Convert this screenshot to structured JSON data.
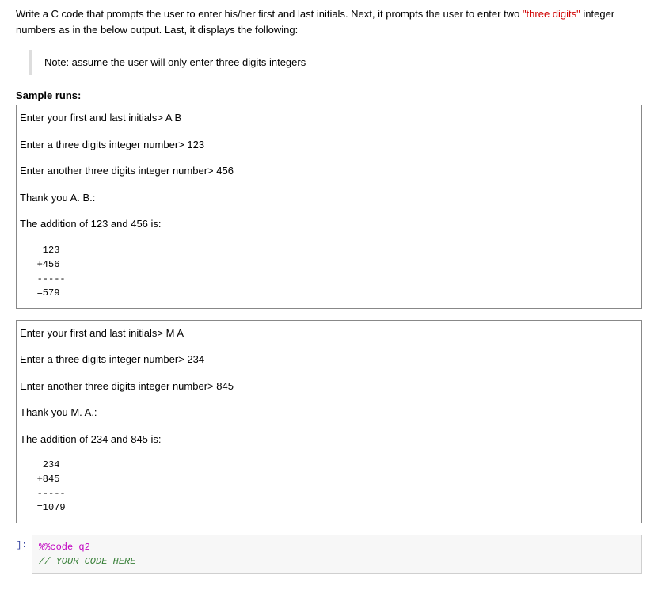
{
  "intro": {
    "part1": "Write a C code that prompts the user to enter his/her first and last initials. Next, it prompts the user to enter two ",
    "highlight": "\"three digits\"",
    "part2": " integer numbers as in the below output. Last, it displays the following:"
  },
  "note": "Note: assume the user will only enter three digits integers",
  "sample_label": "Sample runs:",
  "runs": [
    {
      "l1": "Enter your first and last initials> A B",
      "l2": "Enter a three digits integer number> 123",
      "l3": "Enter another three digits integer number> 456",
      "l4": "Thank you A. B.:",
      "l5": "The addition of 123 and 456 is:",
      "calc": "    123\n   +456\n   -----\n   =579"
    },
    {
      "l1": "Enter your first and last initials> M A",
      "l2": "Enter a three digits integer number> 234",
      "l3": "Enter another three digits integer number> 845",
      "l4": "Thank you M. A.:",
      "l5": "The addition of 234 and 845 is:",
      "calc": "    234\n   +845\n   -----\n   =1079"
    }
  ],
  "code_cell": {
    "prompt": "]:",
    "magic": "%%code q2",
    "comment": "// YOUR CODE HERE"
  }
}
